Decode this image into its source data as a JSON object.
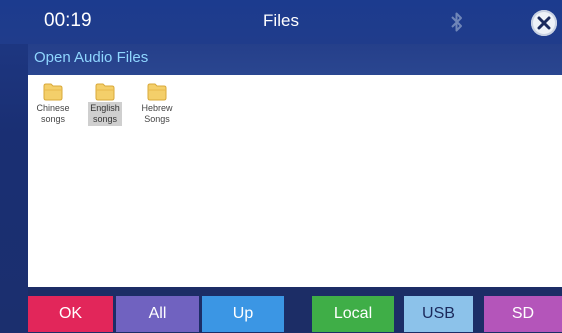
{
  "status_bar": {
    "time": "00:19",
    "title": "Files",
    "bluetooth_icon": "bluetooth-icon",
    "close_icon": "close-icon"
  },
  "subheader": {
    "title": "Open Audio Files"
  },
  "folders": [
    {
      "name_line1": "Chinese",
      "name_line2": "songs",
      "icon": "folder-icon",
      "selected": false
    },
    {
      "name_line1": "English",
      "name_line2": "songs",
      "icon": "folder-icon",
      "selected": true
    },
    {
      "name_line1": "Hebrew",
      "name_line2": "Songs",
      "icon": "folder-icon",
      "selected": false
    }
  ],
  "buttons": [
    {
      "label": "OK",
      "color": "#e2265a"
    },
    {
      "label": "All",
      "color": "#7062c0"
    },
    {
      "label": "Up",
      "color": "#3b96e4"
    },
    {
      "label": "Local",
      "color": "#3fae47"
    },
    {
      "label": "USB",
      "color": "#8cc2ea"
    },
    {
      "label": "SD",
      "color": "#b455ba"
    }
  ],
  "colors": {
    "header_bg": "#1c3b8e",
    "subtitle_text": "#8fd6ff",
    "folder_fill": "#f4cf6a",
    "selected_label_bg": "#cfcfcf"
  }
}
